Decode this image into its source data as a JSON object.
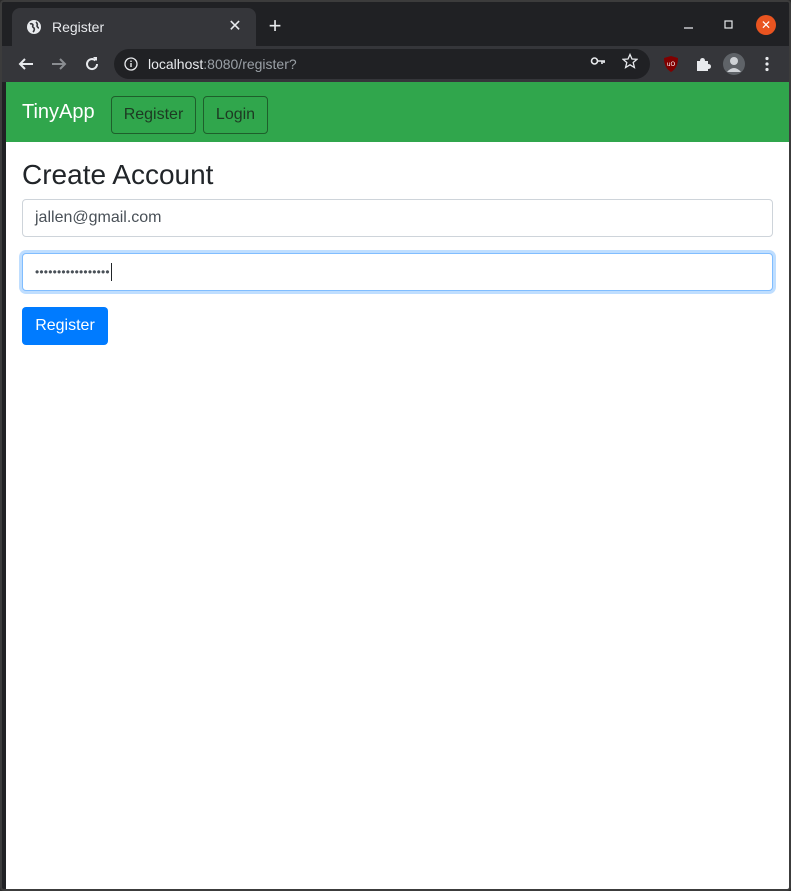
{
  "browser": {
    "tab_title": "Register",
    "url_host": "localhost",
    "url_rest": ":8080/register?"
  },
  "navbar": {
    "brand": "TinyApp",
    "register_label": "Register",
    "login_label": "Login"
  },
  "form": {
    "heading": "Create Account",
    "email_value": "jallen@gmail.com",
    "password_masked": "•••••••••••••••••",
    "submit_label": "Register"
  },
  "colors": {
    "navbar": "#30a64c",
    "primary_button": "#007bff"
  }
}
